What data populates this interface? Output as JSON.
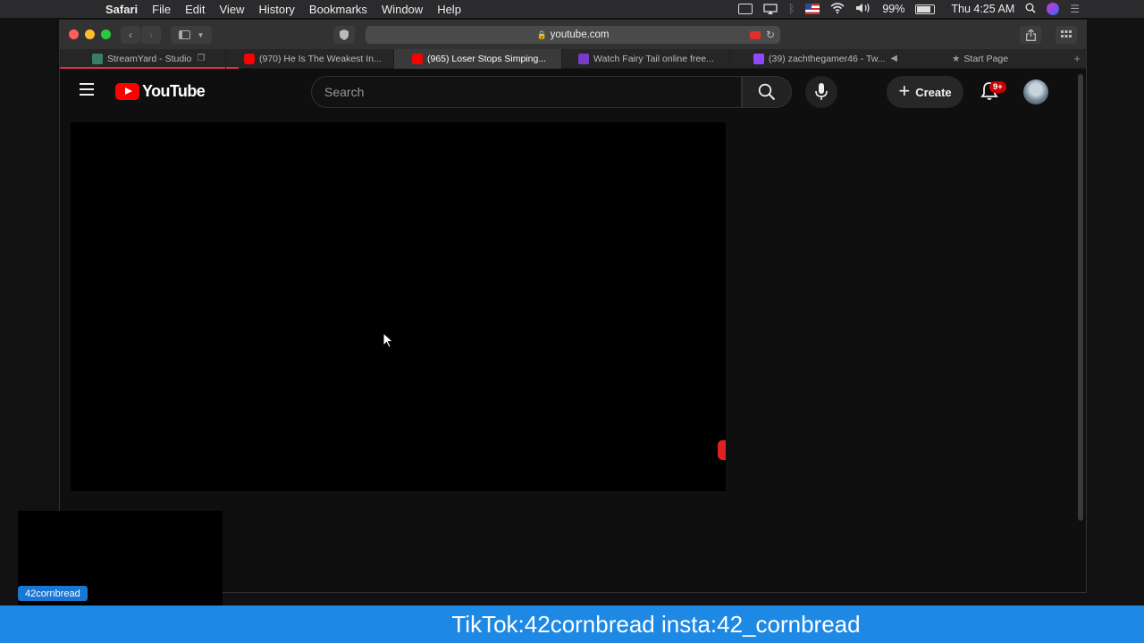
{
  "menubar": {
    "app_name": "Safari",
    "items": [
      "File",
      "Edit",
      "View",
      "History",
      "Bookmarks",
      "Window",
      "Help"
    ],
    "battery_percent": "99%",
    "clock": "Thu 4:25 AM"
  },
  "browser": {
    "url": "youtube.com",
    "tabs": [
      {
        "label": "StreamYard - Studio",
        "favicon_color": "#3a7d6a",
        "active": false
      },
      {
        "label": "(970) He Is The Weakest In...",
        "favicon_color": "#ff0000",
        "active": false
      },
      {
        "label": "(965) Loser Stops Simping...",
        "favicon_color": "#ff0000",
        "active": true
      },
      {
        "label": "Watch Fairy Tail online free...",
        "favicon_color": "#7a3cc8",
        "active": false
      },
      {
        "label": "(39) zachthegamer46 - Tw...",
        "favicon_color": "#9146ff",
        "active": false
      },
      {
        "label": "Start Page",
        "favicon_color": "#888888",
        "active": false
      }
    ]
  },
  "youtube": {
    "logo_text": "YouTube",
    "search_placeholder": "Search",
    "create_label": "Create",
    "notification_badge": "9+"
  },
  "overlay": {
    "cam_name": "42cornbread",
    "banner_text": "TikTok:42cornbread insta:42_cornbread"
  }
}
